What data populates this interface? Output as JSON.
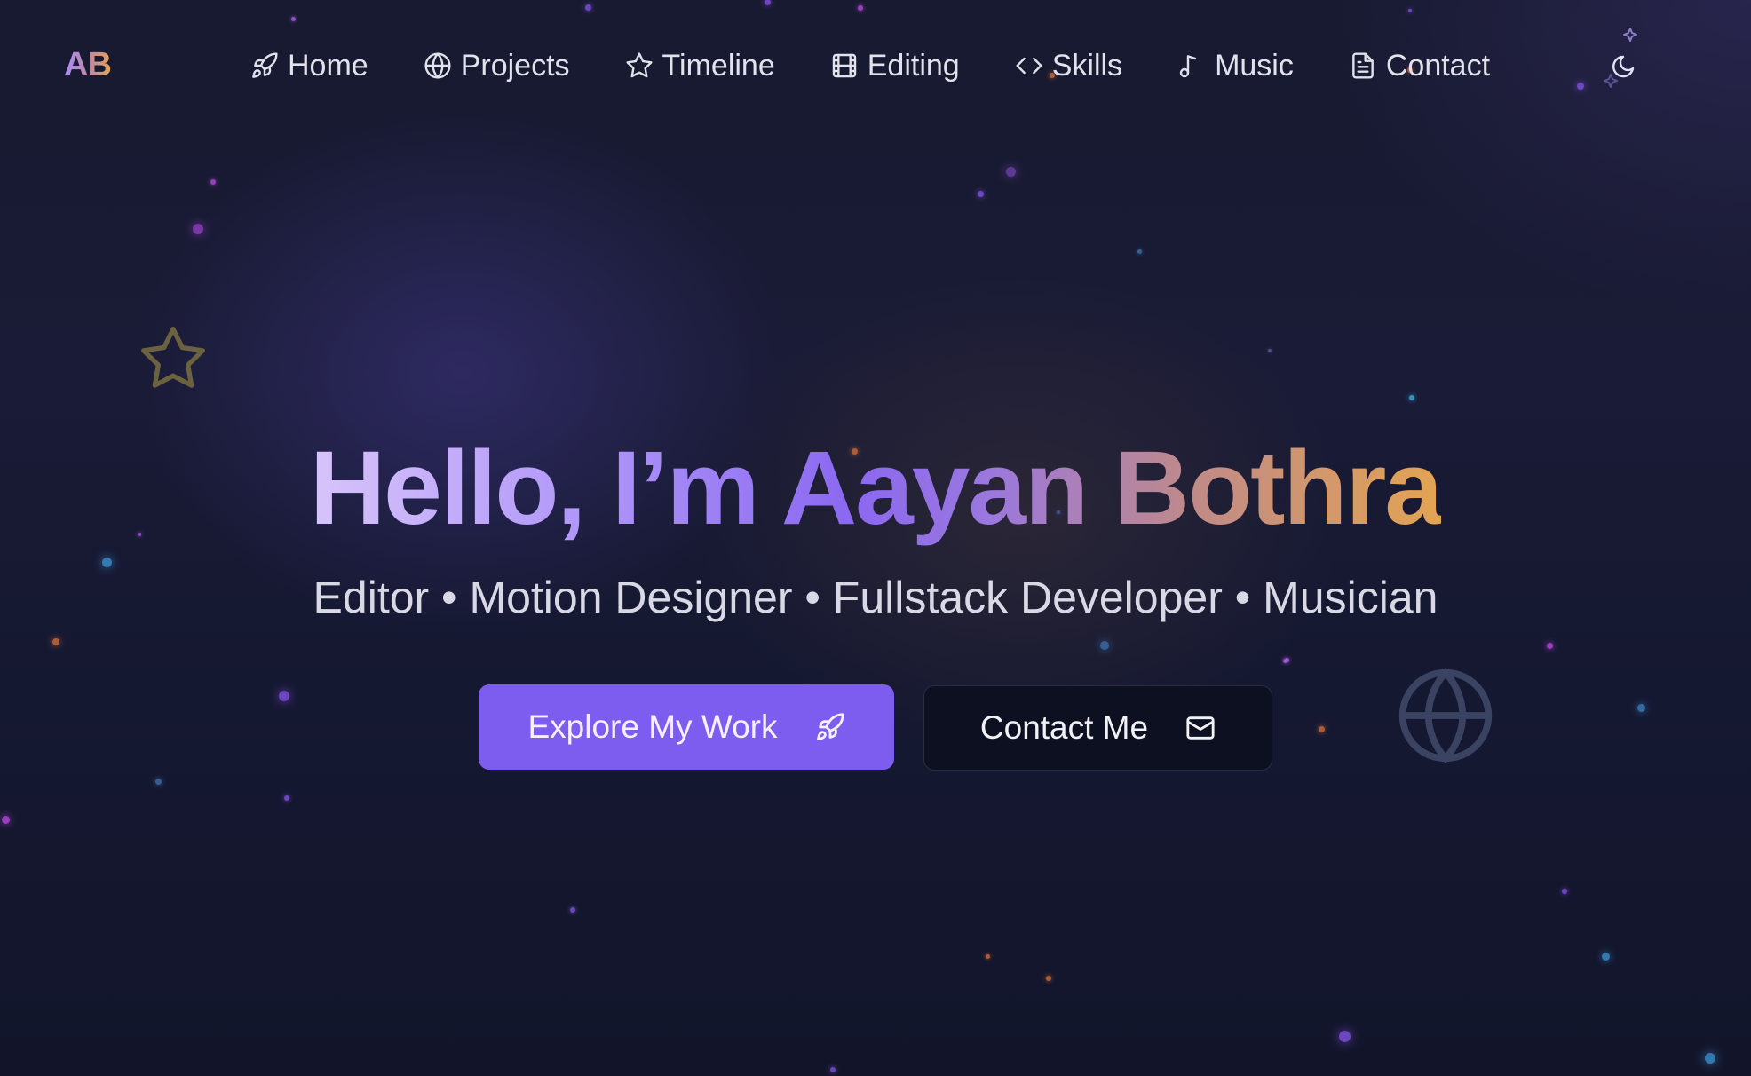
{
  "logo": {
    "text": "AB"
  },
  "nav": {
    "items": [
      {
        "label": "Home",
        "icon": "rocket-icon"
      },
      {
        "label": "Projects",
        "icon": "globe-icon"
      },
      {
        "label": "Timeline",
        "icon": "star-icon"
      },
      {
        "label": "Editing",
        "icon": "film-icon"
      },
      {
        "label": "Skills",
        "icon": "code-icon"
      },
      {
        "label": "Music",
        "icon": "music-note-icon"
      },
      {
        "label": "Contact",
        "icon": "file-text-icon"
      }
    ],
    "theme_toggle_icon": "moon-icon"
  },
  "hero": {
    "title": "Hello, I’m Aayan Bothra",
    "subtitle": "Editor • Motion Designer • Fullstack Developer • Musician",
    "primary_button": {
      "label": "Explore My Work",
      "icon": "rocket-icon"
    },
    "secondary_button": {
      "label": "Contact Me",
      "icon": "mail-icon"
    }
  },
  "decorations": [
    "star-outline-icon",
    "globe-icon"
  ],
  "colors": {
    "accent": "#7d5cf0",
    "gradient_start": "#d8c4fb",
    "gradient_mid": "#8b68f0",
    "gradient_end": "#e3a452",
    "background": "#171a30",
    "secondary_button": "#0d1020"
  }
}
